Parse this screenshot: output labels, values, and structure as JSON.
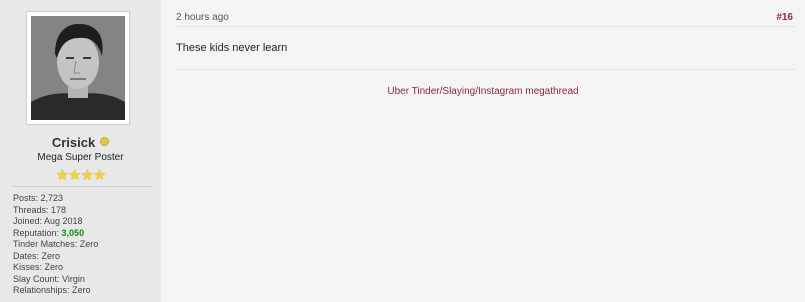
{
  "user": {
    "username": "Crisick",
    "title": "Mega Super Poster",
    "stars": "★★★★",
    "stats": {
      "posts": "Posts: 2,723",
      "threads": "Threads: 178",
      "joined": "Joined: Aug 2018",
      "reputation_label": "Reputation: ",
      "reputation_value": "3,050",
      "tinder_matches": "Tinder Matches: Zero",
      "dates": "Dates: Zero",
      "kisses": "Kisses: Zero",
      "slay_count": "Slay Count: Virgin",
      "relationships": "Relationships: Zero"
    }
  },
  "post": {
    "timestamp": "2 hours ago",
    "number": "#16",
    "message": "These kids never learn",
    "signature_link": "Uber Tinder/Slaying/Instagram megathread"
  },
  "colors": {
    "accent": "#8a2b3b",
    "reputation": "#138a13",
    "online": "#e6c64a"
  }
}
